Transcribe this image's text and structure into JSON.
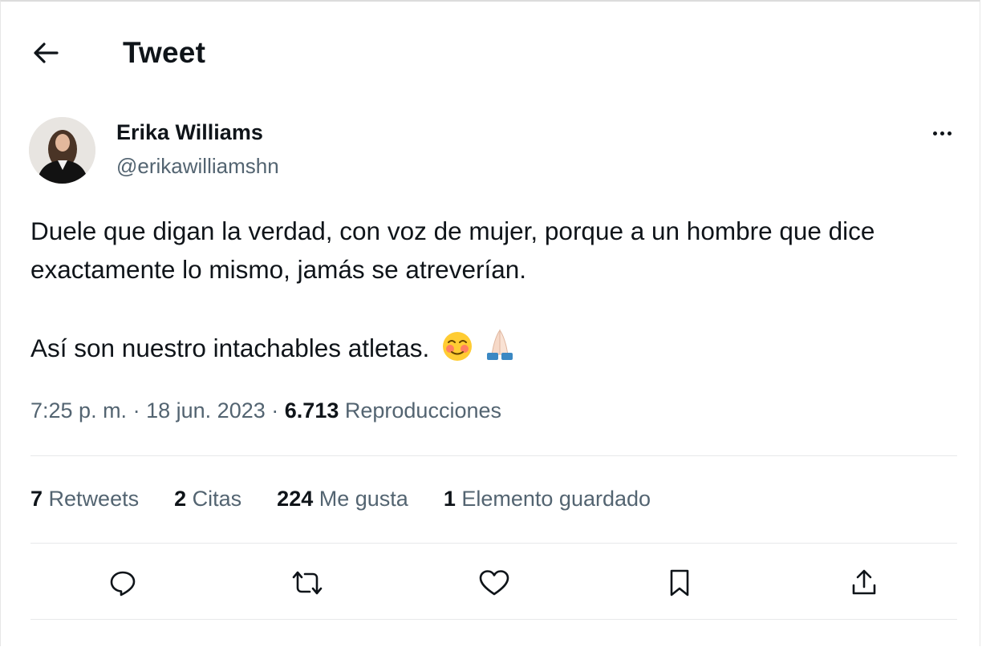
{
  "header": {
    "title": "Tweet",
    "back_icon": "arrow-left-icon"
  },
  "author": {
    "display_name": "Erika Williams",
    "handle": "@erikawilliamshn"
  },
  "tweet": {
    "paragraph1": "Duele que digan la verdad, con voz de mujer, porque a un hombre que dice exactamente lo mismo, jamás se atreverían.",
    "paragraph2": "Así son nuestro intachables atletas.",
    "emojis": [
      "smiling-blushing-face-emoji",
      "folded-hands-emoji"
    ]
  },
  "meta": {
    "time": "7:25 p. m.",
    "separator": "·",
    "date": "18 jun. 2023",
    "views_count": "6.713",
    "views_label": "Reproducciones"
  },
  "stats": [
    {
      "count": "7",
      "label": "Retweets"
    },
    {
      "count": "2",
      "label": "Citas"
    },
    {
      "count": "224",
      "label": "Me gusta"
    },
    {
      "count": "1",
      "label": "Elemento guardado"
    }
  ],
  "actions": [
    "reply-icon",
    "retweet-icon",
    "like-icon",
    "bookmark-icon",
    "share-icon"
  ],
  "colors": {
    "text_primary": "#0f1419",
    "text_secondary": "#536471",
    "divider": "#e7e9ea"
  }
}
